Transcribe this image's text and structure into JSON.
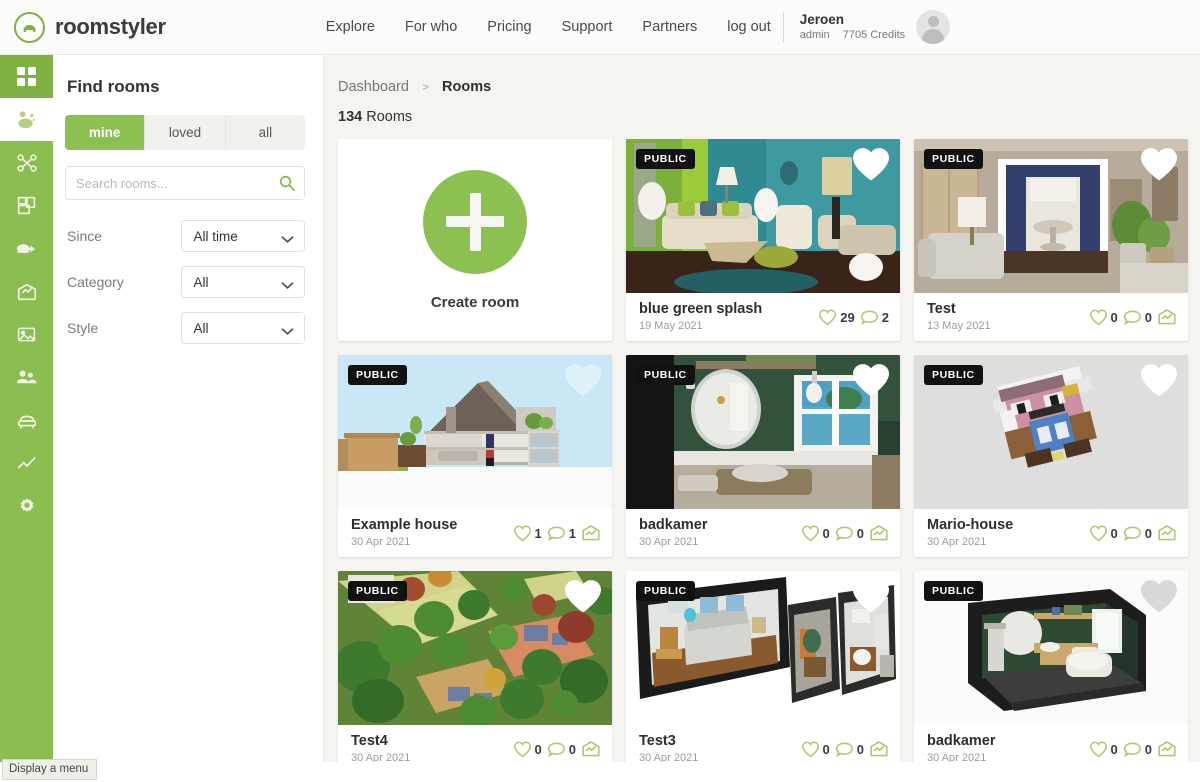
{
  "brand": {
    "name": "roomstyler",
    "logo_icon": "armchair-circle-icon",
    "accent": "#8cc152"
  },
  "topnav": {
    "items": [
      {
        "label": "Explore"
      },
      {
        "label": "For who"
      },
      {
        "label": "Pricing"
      },
      {
        "label": "Support"
      },
      {
        "label": "Partners"
      },
      {
        "label": "log out"
      }
    ],
    "user": {
      "name": "Jeroen",
      "role": "admin",
      "credits": "7705 Credits",
      "avatar_icon": "user-avatar-icon"
    }
  },
  "rail": {
    "items": [
      {
        "icon": "grid-dashboard-icon",
        "state": "active"
      },
      {
        "icon": "room-sparkle-icon",
        "state": "selected"
      },
      {
        "icon": "scissors-nodes-icon",
        "state": "default"
      },
      {
        "icon": "floorplan-icon",
        "state": "default"
      },
      {
        "icon": "sofa-arrow-icon",
        "state": "default"
      },
      {
        "icon": "share-export-icon",
        "state": "default"
      },
      {
        "icon": "image-icon",
        "state": "default"
      },
      {
        "icon": "group-users-icon",
        "state": "default"
      },
      {
        "icon": "armchair-icon",
        "state": "default"
      },
      {
        "icon": "line-chart-icon",
        "state": "default"
      },
      {
        "icon": "gear-icon",
        "state": "default"
      }
    ]
  },
  "filters": {
    "title": "Find rooms",
    "tabs": [
      {
        "label": "mine",
        "active": true
      },
      {
        "label": "loved",
        "active": false
      },
      {
        "label": "all",
        "active": false
      }
    ],
    "search": {
      "placeholder": "Search rooms...",
      "value": "",
      "icon": "search-icon"
    },
    "fields": [
      {
        "label": "Since",
        "value": "All time"
      },
      {
        "label": "Category",
        "value": "All"
      },
      {
        "label": "Style",
        "value": "All"
      }
    ]
  },
  "main": {
    "breadcrumb": {
      "root": "Dashboard",
      "separator": ">",
      "current": "Rooms"
    },
    "count_number": "134",
    "count_label": "Rooms",
    "create_card": {
      "label": "Create room",
      "icon": "plus-icon"
    },
    "rooms": [
      {
        "title": "blue green splash",
        "date": "19 May 2021",
        "visibility": "PUBLIC",
        "likes": "29",
        "comments": "2",
        "loved": true,
        "has_share": false,
        "art": "living-teal"
      },
      {
        "title": "Test",
        "date": "13 May 2021",
        "visibility": "PUBLIC",
        "likes": "0",
        "comments": "0",
        "loved": true,
        "has_share": true,
        "art": "beige-room"
      },
      {
        "title": "Example house",
        "date": "30 Apr 2021",
        "visibility": "PUBLIC",
        "likes": "1",
        "comments": "1",
        "loved": false,
        "has_share": true,
        "art": "house-section"
      },
      {
        "title": "badkamer",
        "date": "30 Apr 2021",
        "visibility": "PUBLIC",
        "likes": "0",
        "comments": "0",
        "loved": true,
        "has_share": true,
        "art": "green-bath"
      },
      {
        "title": "Mario-house",
        "date": "30 Apr 2021",
        "visibility": "PUBLIC",
        "likes": "0",
        "comments": "0",
        "loved": true,
        "has_share": true,
        "art": "mario"
      },
      {
        "title": "Test4",
        "date": "30 Apr 2021",
        "visibility": "PUBLIC",
        "likes": "0",
        "comments": "0",
        "loved": true,
        "has_share": true,
        "art": "aerial"
      },
      {
        "title": "Test3",
        "date": "30 Apr 2021",
        "visibility": "PUBLIC",
        "likes": "0",
        "comments": "0",
        "loved": true,
        "has_share": true,
        "art": "iso-apartment"
      },
      {
        "title": "badkamer",
        "date": "30 Apr 2021",
        "visibility": "PUBLIC",
        "likes": "0",
        "comments": "0",
        "loved": false,
        "has_share": true,
        "art": "iso-bath"
      }
    ]
  },
  "statusbar": {
    "text": "Display a menu"
  }
}
